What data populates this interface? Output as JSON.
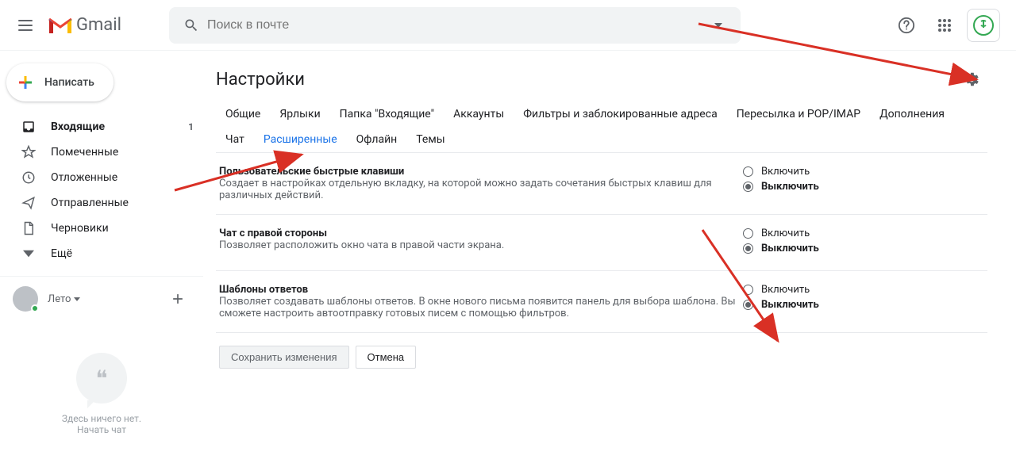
{
  "header": {
    "logo_text": "Gmail",
    "search_placeholder": "Поиск в почте"
  },
  "compose": {
    "label": "Написать"
  },
  "sidebar": {
    "items": [
      {
        "label": "Входящие",
        "badge": "1"
      },
      {
        "label": "Помеченные"
      },
      {
        "label": "Отложенные"
      },
      {
        "label": "Отправленные"
      },
      {
        "label": "Черновики"
      },
      {
        "label": "Ещё"
      }
    ]
  },
  "chat": {
    "user_name": "Лето",
    "empty_text": "Здесь ничего нет.",
    "start_chat": "Начать чат"
  },
  "main": {
    "title": "Настройки",
    "tabs_row1": [
      "Общие",
      "Ярлыки",
      "Папка \"Входящие\"",
      "Аккаунты",
      "Фильтры и заблокированные адреса",
      "Пересылка и POP/IMAP",
      "Дополнения"
    ],
    "tabs_row2": [
      "Чат",
      "Расширенные",
      "Офлайн",
      "Темы"
    ],
    "active_tab": "Расширенные"
  },
  "settings": [
    {
      "title": "Пользовательские быстрые клавиши",
      "desc": "Создает в настройках отдельную вкладку, на которой можно задать сочетания быстрых клавиш для различных действий.",
      "opt_on": "Включить",
      "opt_off": "Выключить",
      "selected": "off"
    },
    {
      "title": "Чат с правой стороны",
      "desc": "Позволяет расположить окно чата в правой части экрана.",
      "opt_on": "Включить",
      "opt_off": "Выключить",
      "selected": "off"
    },
    {
      "title": "Шаблоны ответов",
      "desc": "Позволяет создавать шаблоны ответов. В окне нового письма появится панель для выбора шаблона. Вы сможете настроить автоотправку готовых писем с помощью фильтров.",
      "opt_on": "Включить",
      "opt_off": "Выключить",
      "selected": "off"
    }
  ],
  "buttons": {
    "save": "Сохранить изменения",
    "cancel": "Отмена"
  },
  "colors": {
    "accent": "#1a73e8",
    "arrow": "#d93025",
    "green": "#34a853"
  }
}
